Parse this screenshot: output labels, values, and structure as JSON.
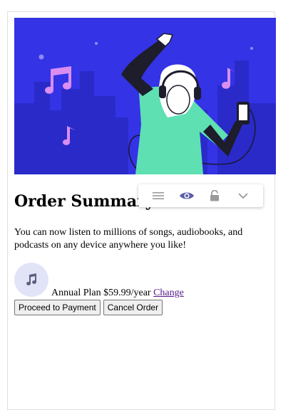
{
  "order": {
    "title": "Order Summary",
    "description": "You can now listen to millions of songs, audiobooks, and podcasts on any device anywhere you like!",
    "plan_label": "Annual Plan",
    "plan_price": "$59.99/year",
    "change_link": "Change",
    "proceed_button": "Proceed to Payment",
    "cancel_button": "Cancel Order"
  },
  "icons": {
    "plan": "music-note-icon",
    "toolbar": [
      "menu-icon",
      "eye-icon",
      "lock-icon",
      "chevron-down-icon"
    ]
  },
  "colors": {
    "hero_bg": "#3433e6",
    "accent_link": "#551a8b",
    "plan_icon_bg": "#e1e4f7",
    "toolbar_eye": "#5b5fa8"
  }
}
